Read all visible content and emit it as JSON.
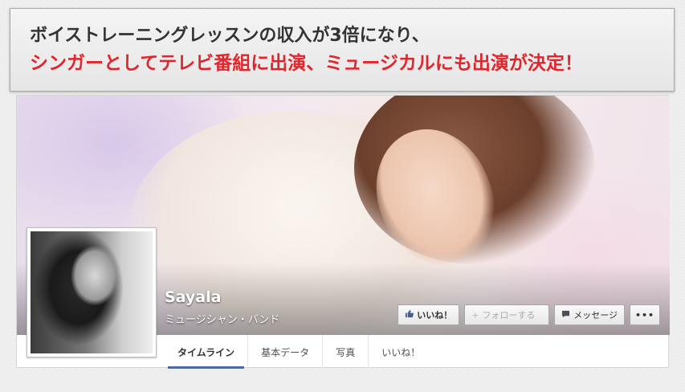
{
  "banner": {
    "line1": "ボイストレーニングレッスンの収入が3倍になり、",
    "line2": "シンガーとしてテレビ番組に出演、ミュージカルにも出演が決定！"
  },
  "page": {
    "name": "Sayala",
    "category": "ミュージシャン・バンド"
  },
  "actions": {
    "like_icon": "thumbs-up-icon",
    "like_label": "いいね！",
    "follow_icon": "plus-icon",
    "follow_label": "フォローする",
    "message_icon": "speech-bubble-icon",
    "message_label": "メッセージ",
    "more_label": "•••"
  },
  "tabs": [
    {
      "label": "タイムライン",
      "active": true
    },
    {
      "label": "基本データ"
    },
    {
      "label": "写真"
    },
    {
      "label": "いいね！"
    }
  ],
  "colors": {
    "banner_highlight": "#e0262d",
    "tab_underline": "#4e69a2"
  }
}
